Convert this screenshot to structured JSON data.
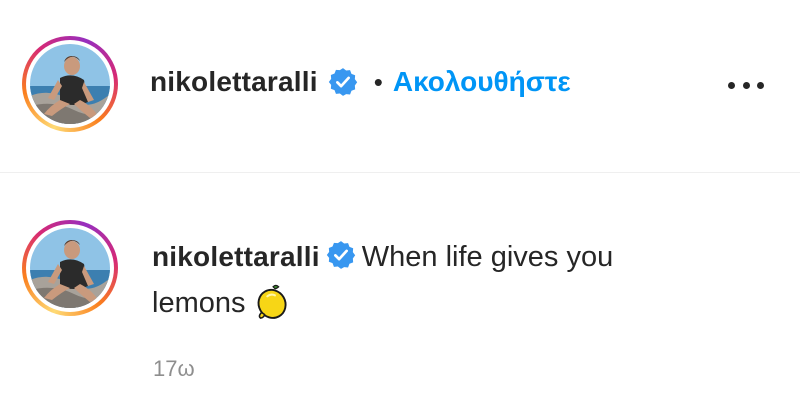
{
  "header": {
    "username": "nikolettaralli",
    "separator": "•",
    "follow_label": "Ακολουθήστε",
    "more_icon": "more-horizontal-icon"
  },
  "caption": {
    "username": "nikolettaralli",
    "text_line1": "When life gives you",
    "text_line2": "lemons",
    "emoji": "lemon-emoji",
    "timestamp": "17ω"
  },
  "colors": {
    "link": "#0095f6",
    "verified": "#3897f0",
    "text": "#262626",
    "muted": "#8e8e8e",
    "divider": "#efefef"
  }
}
